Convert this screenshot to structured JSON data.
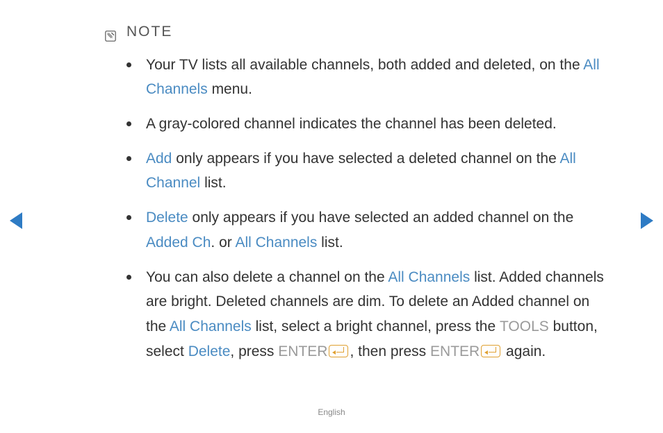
{
  "note_label": "NOTE",
  "bullets": {
    "b1_a": "Your TV lists all available channels, both added and deleted, on the ",
    "b1_b": "All Channels",
    "b1_c": " menu.",
    "b2": "A gray-colored channel indicates the channel has been deleted.",
    "b3_a": "Add",
    "b3_b": " only appears if you have selected a deleted channel on the ",
    "b3_c": "All Channel",
    "b3_d": " list.",
    "b4_a": "Delete",
    "b4_b": " only appears if you have selected an added channel on the ",
    "b4_c": "Added Ch",
    "b4_d": ". or ",
    "b4_e": "All Channels",
    "b4_f": " list.",
    "b5_a": "You can also delete a channel on the ",
    "b5_b": "All Channels",
    "b5_c": " list. Added channels are bright. Deleted channels are dim. To delete an Added channel on the ",
    "b5_d": "All Channels",
    "b5_e": " list, select a bright channel, press the ",
    "b5_f": "TOOLS",
    "b5_g": " button, select ",
    "b5_h": "Delete",
    "b5_i": ", press ",
    "b5_j": "ENTER",
    "b5_k": ", then press ",
    "b5_l": "ENTER",
    "b5_m": " again."
  },
  "footer": "English"
}
